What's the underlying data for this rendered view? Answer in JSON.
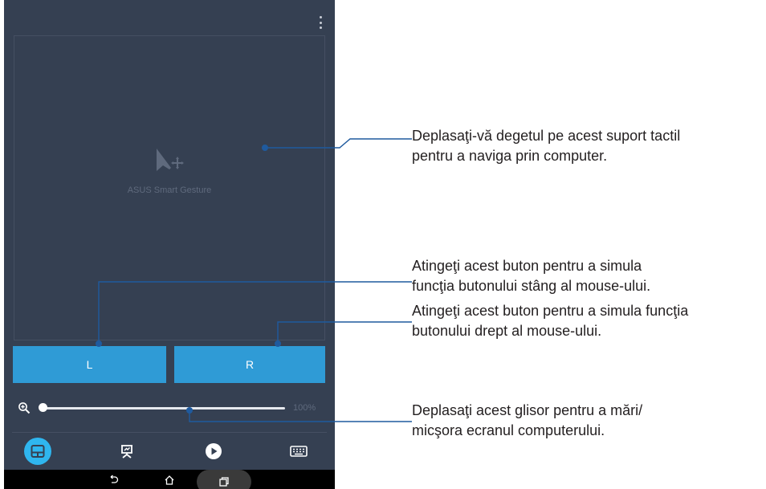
{
  "app": {
    "touchpad_watermark": "ASUS Smart Gesture",
    "left_button_label": "L",
    "right_button_label": "R",
    "zoom_value": "100%",
    "zoom_level_percent": 0,
    "accent_color": "#2f9bd6",
    "active_tab_color": "#2fb6ef",
    "background_color": "#354052",
    "tabs": [
      {
        "icon": "touchpad-icon",
        "active": true
      },
      {
        "icon": "presentation-icon",
        "active": false
      },
      {
        "icon": "play-icon",
        "active": false
      },
      {
        "icon": "keyboard-icon",
        "active": false
      }
    ],
    "nav_icons": [
      "back-icon",
      "home-icon",
      "recent-apps-icon"
    ]
  },
  "annotations": {
    "touchpad": [
      "Deplasaţi-vă degetul pe acest suport tactil",
      "pentru a naviga prin computer."
    ],
    "left_button": [
      "Atingeţi acest buton pentru a simula",
      "funcţia butonului stâng al mouse-ului."
    ],
    "right_button": [
      "Atingeţi acest buton pentru a simula funcţia",
      "butonului drept al mouse-ului."
    ],
    "slider": [
      "Deplasaţi acest glisor pentru a mări/",
      "micşora ecranul computerului."
    ]
  }
}
